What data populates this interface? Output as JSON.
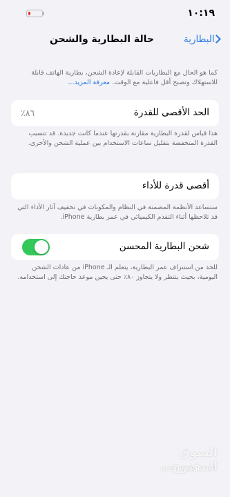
{
  "status_bar": {
    "time": "١٠:١٩",
    "battery_level": 0.15,
    "battery_color": "#e0302b"
  },
  "nav": {
    "title": "حالة البطارية والشحن",
    "back_label": "البطارية",
    "back_icon": "chevron-left-icon"
  },
  "intro": {
    "text": "كما هو الحال مع البطاريات القابلة لإعادة الشحن، بطارية الهاتف قابلة للاستهلاك وتصبح أقل فاعلية مع الوقت.",
    "link": "معرفة المزيد..."
  },
  "max_capacity": {
    "label": "الحد الأقصى للقدرة",
    "value": "٨٦٪",
    "footer": "هذا قياس لقدرة البطارية مقارنة بقدرتها عندما كانت جديدة. قد تتسبب القدرة المنخفضة بتقليل ساعات الاستخدام بين عملية الشحن والأخرى."
  },
  "peak_performance": {
    "label": "أقصى قدرة للأداء",
    "footer": "ستساعد الأنظمة المضمنة في النظام والمكونات في تخفيف آثار الأداء التي قد تلاحظها أثناء التقدم الكيميائي في عمر بطارية iPhone."
  },
  "optimized_charging": {
    "label": "شحن البطارية المحسن",
    "enabled": true,
    "toggle_color": "#34c759",
    "footer": "للحد من استنزاف عمر البطارية، يتعلم الـ iPhone من عادات الشحن اليومية، بحيث ينتظر ولا يتجاوز ٨٠٪ حتى يحين موعد حاجتك إلى استخدامه."
  },
  "watermark": {
    "arabic": "السوق المفتوح",
    "latin": "opensooq.com"
  }
}
